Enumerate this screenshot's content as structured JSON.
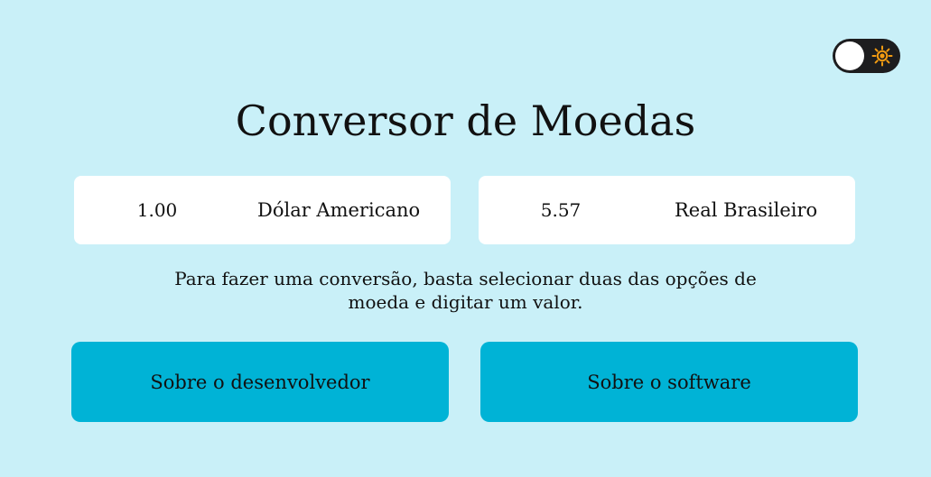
{
  "theme_toggle": {
    "state": "light",
    "icon": "sun-icon",
    "track_color": "#1d1d1f",
    "knob_color": "#ffffff",
    "icon_color": "#f39c12"
  },
  "title": "Conversor de Moedas",
  "converter": {
    "from": {
      "amount": "1.00",
      "currency": "Dólar Americano"
    },
    "to": {
      "amount": "5.57",
      "currency": "Real Brasileiro"
    }
  },
  "instructions": {
    "line1": "Para fazer uma conversão, basta selecionar duas das opções de",
    "line2": "moeda e digitar um valor."
  },
  "buttons": {
    "about_developer": "Sobre o desenvolvedor",
    "about_software": "Sobre o software"
  },
  "colors": {
    "background": "#c9f0f8",
    "button": "#00b3d6",
    "card": "#ffffff",
    "text": "#111111"
  }
}
